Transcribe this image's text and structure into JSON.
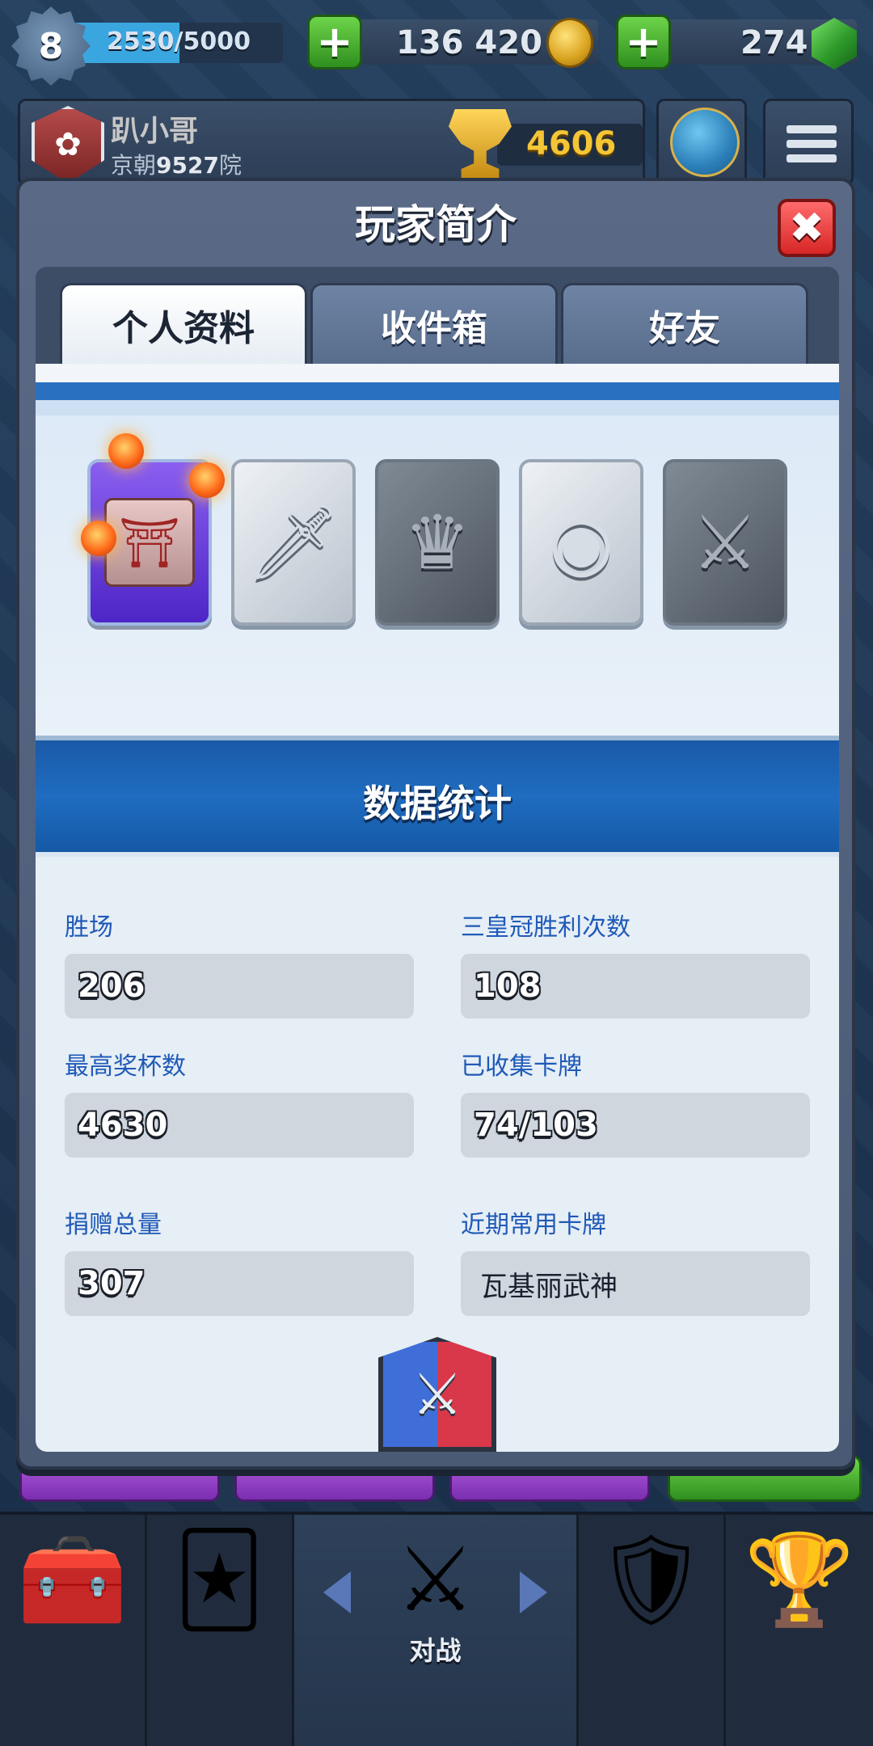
{
  "topbar": {
    "level": "8",
    "xp_text": "2530/5000",
    "xp_fraction": 0.506,
    "plus_label": "+",
    "gold": "136 420",
    "gems": "274"
  },
  "player": {
    "name": "趴小哥",
    "clan_prefix": "京朝",
    "clan_number": "9527",
    "clan_suffix": "院",
    "trophies": "4606"
  },
  "modal": {
    "title": "玩家简介",
    "close_label": "✖",
    "tabs": [
      {
        "label": "个人资料",
        "active": true
      },
      {
        "label": "收件箱",
        "active": false
      },
      {
        "label": "好友",
        "active": false
      }
    ],
    "badges": [
      {
        "icon": "arena-icon"
      },
      {
        "icon": "sword-laurel-icon"
      },
      {
        "icon": "crown-icon"
      },
      {
        "icon": "medal-icon"
      },
      {
        "icon": "crossed-swords-shield-icon"
      }
    ],
    "stats_title": "数据统计",
    "stats": [
      {
        "label": "胜场",
        "value": "206"
      },
      {
        "label": "三皇冠胜利次数",
        "value": "108"
      },
      {
        "label": "最高奖杯数",
        "value": "4630"
      },
      {
        "label": "已收集卡牌",
        "value": "74/103"
      },
      {
        "label": "捐赠总量",
        "value": "307"
      },
      {
        "label": "近期常用卡牌",
        "value": "瓦基丽武神"
      }
    ]
  },
  "nav": {
    "battle_label": "对战"
  },
  "colors": {
    "stat_label": "#1f5ab8",
    "close_button": "#d72626",
    "xp_fill": "#3aa6e0",
    "trophy_text": "#f4c535"
  }
}
